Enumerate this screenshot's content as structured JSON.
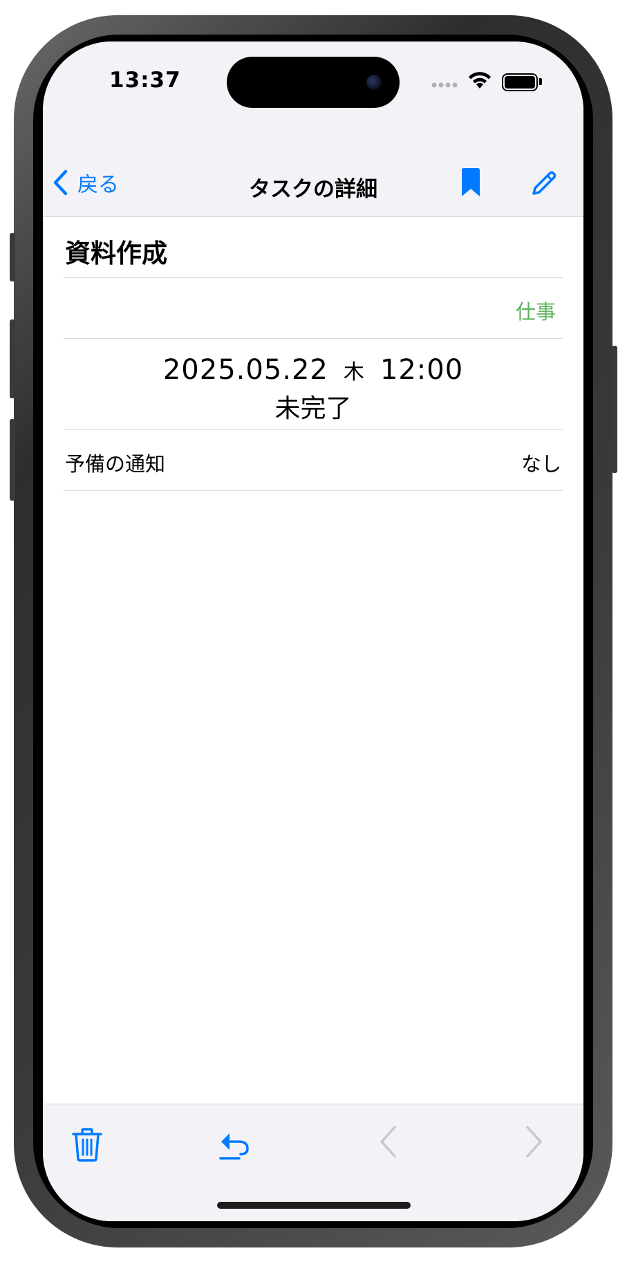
{
  "status_bar": {
    "time": "13:37"
  },
  "nav": {
    "back_label": "戻る",
    "title": "タスクの詳細"
  },
  "task": {
    "title": "資料作成",
    "category": "仕事",
    "date": "2025.05.22",
    "weekday": "木",
    "time": "12:00",
    "status": "未完了",
    "notify_label": "予備の通知",
    "notify_value": "なし"
  },
  "colors": {
    "accent": "#007aff",
    "category": "#5db35b",
    "disabled": "#c7c7cc",
    "bar_background": "#f2f2f7"
  },
  "icons": {
    "back": "chevron-left-icon",
    "bookmark": "bookmark-icon",
    "edit": "pencil-icon",
    "delete": "trash-icon",
    "undo": "undo-arrow-icon",
    "previous": "chevron-left-icon",
    "next": "chevron-right-icon"
  }
}
